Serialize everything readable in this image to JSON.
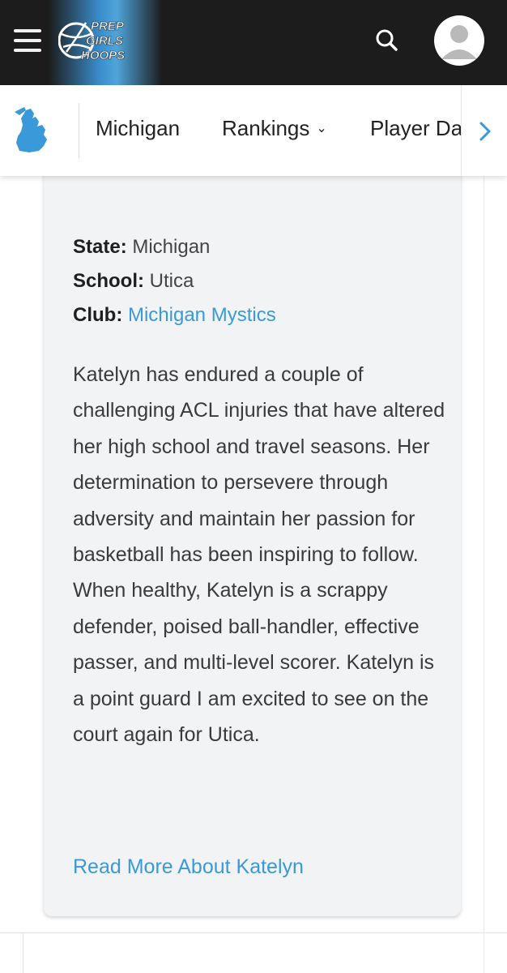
{
  "header": {
    "logo_text": [
      "PREP",
      "GIRLS",
      "HOOPS"
    ],
    "brand_color": "#3a9ad9",
    "icons": [
      "hamburger-menu-icon",
      "search-icon",
      "user-avatar-icon"
    ]
  },
  "nav": {
    "state_icon": "michigan-state-icon",
    "items": [
      {
        "label": "Michigan"
      },
      {
        "label": "Rankings",
        "dropdown": true
      },
      {
        "label": "Player Da"
      }
    ],
    "next_icon": "chevron-right-icon"
  },
  "profile": {
    "state_label": "State:",
    "state_value": "Michigan",
    "school_label": "School:",
    "school_value": "Utica",
    "club_label": "Club:",
    "club_value": "Michigan Mystics",
    "bio": "Katelyn has endured a couple of challenging ACL injuries that have altered her high school and travel seasons. Her determination to persevere through adversity and maintain her passion for basketball has been inspiring to follow. When healthy, Katelyn is a scrappy defender, poised ball-handler, effective passer, and multi-level scorer. Katelyn is a point guard I am excited to see on the court again for Utica.",
    "read_more": "Read More About Katelyn"
  }
}
